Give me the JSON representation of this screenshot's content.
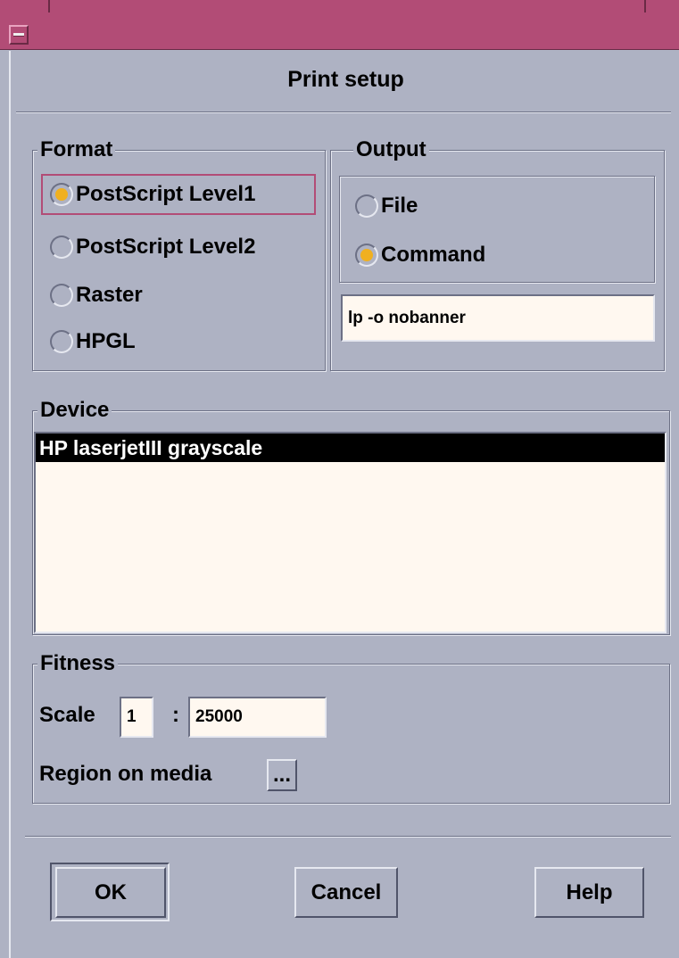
{
  "dialog": {
    "title": "Print setup"
  },
  "format": {
    "label": "Format",
    "options": [
      {
        "label": "PostScript Level1",
        "selected": true
      },
      {
        "label": "PostScript Level2",
        "selected": false
      },
      {
        "label": "Raster",
        "selected": false
      },
      {
        "label": "HPGL",
        "selected": false
      }
    ]
  },
  "output": {
    "label": "Output",
    "options": [
      {
        "label": "File",
        "selected": false
      },
      {
        "label": "Command",
        "selected": true
      }
    ],
    "command_value": "lp -o nobanner"
  },
  "device": {
    "label": "Device",
    "items": [
      {
        "label": "HP laserjetIII grayscale",
        "selected": true
      }
    ]
  },
  "fitness": {
    "label": "Fitness",
    "scale_label": "Scale",
    "scale_numerator": "1",
    "scale_separator": ":",
    "scale_denominator": "25000",
    "region_label": "Region on media",
    "region_button": "..."
  },
  "buttons": {
    "ok": "OK",
    "cancel": "Cancel",
    "help": "Help"
  },
  "colors": {
    "title_bar": "#b24c76",
    "background": "#aeb2c3",
    "field": "#fff8f0",
    "radio_on": "#f0b020",
    "focus": "#b24c76"
  }
}
